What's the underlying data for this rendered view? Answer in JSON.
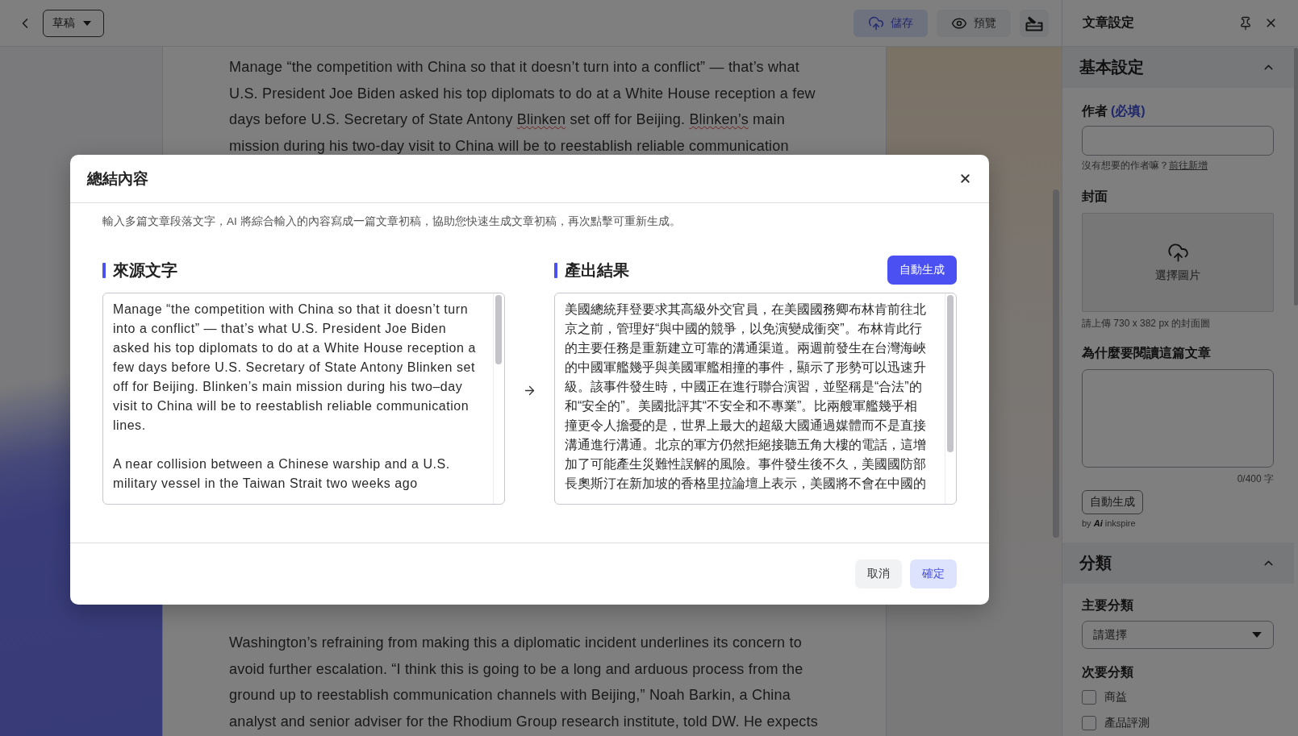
{
  "top_bar": {
    "status_dropdown": "草稿",
    "save_button": "儲存",
    "preview_button": "預覽"
  },
  "editor": {
    "paragraphs": [
      {
        "segments": [
          {
            "text": "Manage “the competition with China so that it doesn’t turn into a conflict” — that’s what U.S. President Joe Biden asked his top diplomats to do at a White House reception a few days before U.S. Secretary of State Antony ",
            "misspelled": false
          },
          {
            "text": "Blinken",
            "misspelled": true
          },
          {
            "text": " set off for Beijing. ",
            "misspelled": false
          },
          {
            "text": "Blinken’s",
            "misspelled": true
          },
          {
            "text": " main mission during his two-day visit to China will be to reestablish reliable communication",
            "misspelled": false
          }
        ]
      },
      {
        "segments": [
          {
            "text": "Washington’s refraining from making this a diplomatic incident underlines its concern to avoid further escalation. “I think this is going to be a long and arduous process from the ground up to reestablish communication channels with Beijing,” Noah Barkin, a China analyst and senior adviser for the Rhodium Group research institute, told DW. He expects",
            "misspelled": false
          }
        ]
      }
    ]
  },
  "sidebar": {
    "title": "文章設定",
    "sections": [
      {
        "kind": "basic",
        "title": "基本設定",
        "expanded": true,
        "author": {
          "label": "作者",
          "required_note": "(必填)",
          "helper": "沒有想要的作者嘛？",
          "helper_link": "前往新增"
        },
        "cover": {
          "label": "封面",
          "upload_label": "選擇圖片",
          "hint": "請上傳 730 x 382 px 的封面圖"
        },
        "reason": {
          "label": "為什麼要閱讀這篇文章",
          "counter": "0/400 字",
          "generate_button": "自動生成",
          "credit": "by **Ai** inkspire"
        }
      },
      {
        "kind": "category",
        "title": "分類",
        "expanded": true,
        "primary": {
          "label": "主要分類",
          "placeholder": "請選擇"
        },
        "secondary": {
          "label": "次要分類",
          "options": [
            {
              "label": "商益",
              "checked": false
            },
            {
              "label": "產品評測",
              "checked": false
            }
          ]
        }
      }
    ]
  },
  "dialog": {
    "title": "總結內容",
    "description": "輸入多篇文章段落文字，AI 將綜合輸入的內容寫成一篇文章初稿，協助您快速生成文章初稿，再次點擊可重新生成。",
    "source": {
      "title": "來源文字",
      "paragraphs": [
        "Manage “the competition with China so that it doesn’t turn into a conflict” — that’s what U.S. President Joe Biden asked his top diplomats to do at a White House reception a few days before U.S. Secretary of State Antony Blinken set off for Beijing. Blinken’s main mission during his two–day visit to China will be to reestablish reliable communication lines.",
        "A near collision between a Chinese warship and a U.S. military vessel in the Taiwan Strait two weeks ago"
      ]
    },
    "result": {
      "title": "產出結果",
      "generate_button": "自動生成",
      "text": "美國總統拜登要求其高級外交官員，在美國國務卿布林肯前往北京之前，管理好“與中國的競爭，以免演變成衝突”。布林肯此行的主要任務是重新建立可靠的溝通渠道。兩週前發生在台灣海峽的中國軍艦幾乎與美國軍艦相撞的事件，顯示了形勢可以迅速升級。該事件發生時，中國正在進行聯合演習，並堅稱是“合法”的和“安全的”。美國批評其“不安全和不專業”。比兩艘軍艦幾乎相撞更令人擔憂的是，世界上最大的超級大國通過媒體而不是直接溝通進行溝通。北京的軍方仍然拒絕接聽五角大樓的電話，這增加了可能產生災難性誤解的風險。事件發生後不久，美國國防部長奧斯汀在新加坡的香格里拉論壇上表示，美國將不會在中國的"
    },
    "buttons": [
      {
        "label": "取消",
        "kind": "neutral"
      },
      {
        "label": "確定",
        "kind": "soft"
      }
    ]
  }
}
